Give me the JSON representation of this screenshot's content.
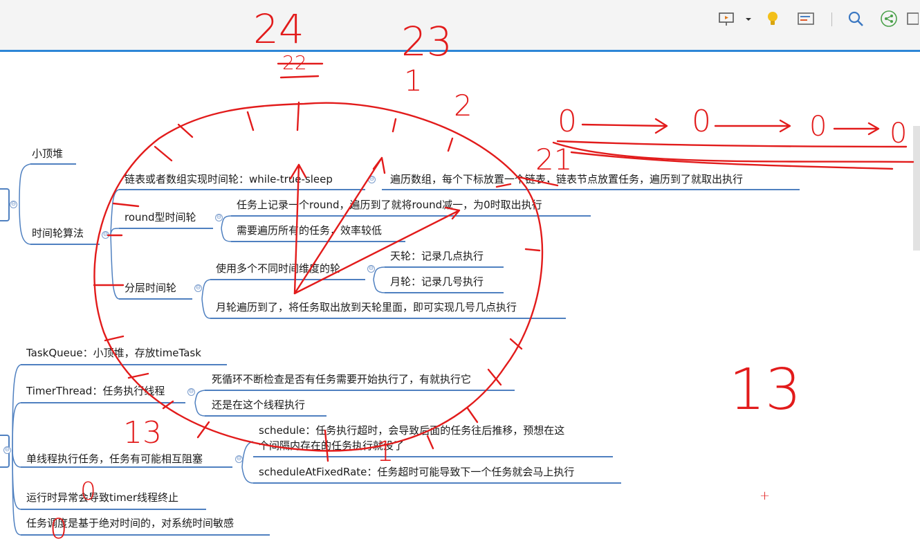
{
  "toolbar": {
    "icons": [
      "presentation-icon",
      "dropdown-arrow-icon",
      "lightbulb-icon",
      "outline-icon",
      "search-icon",
      "share-icon",
      "window-icon"
    ]
  },
  "mindmap": {
    "node_min_heap": "小顶堆",
    "node_time_wheel": "时间轮算法",
    "node_linked": "链表或者数组实现时间轮：while-true-sleep",
    "node_linked_detail": "遍历数组，每个下标放置一个链表，链表节点放置任务，遍历到了就取出执行",
    "node_round": "round型时间轮",
    "node_round_1": "任务上记录一个round，遍历到了就将round减一，为0时取出执行",
    "node_round_2": "需要遍历所有的任务，效率较低",
    "node_layer": "分层时间轮",
    "node_layer_multi": "使用多个不同时间维度的轮",
    "node_day_wheel": "天轮：记录几点执行",
    "node_month_wheel": "月轮：记录几号执行",
    "node_layer_2": "月轮遍历到了，将任务取出放到天轮里面，即可实现几号几点执行",
    "node_taskqueue": "TaskQueue：小顶堆，存放timeTask",
    "node_timerthread": "TimerThread：任务执行线程",
    "node_timerthread_1": "死循环不断检查是否有任务需要开始执行了，有就执行它",
    "node_timerthread_2": "还是在这个线程执行",
    "node_single": "单线程执行任务，任务有可能相互阻塞",
    "node_schedule_line1": "schedule：任务执行超时，会导致后面的任务往后推移，预想在这",
    "node_schedule_line2": "个间隔内存在的任务执行就没了",
    "node_fixed_rate": "scheduleAtFixedRate：任务超时可能导致下一个任务就会马上执行",
    "node_runtime": "运行时异常会导致timer线程终止",
    "node_abs_time": "任务调度是基于绝对时间的，对系统时间敏感",
    "collapse_symbol": "⊖"
  },
  "annotations": {
    "n24": "24",
    "n23": "23",
    "n22": "22",
    "n1": "1",
    "n2": "2",
    "n21": "21",
    "n13_big": "13",
    "n13_small": "13",
    "n1_bottom": "1",
    "zero_1": "0",
    "zero_2": "0",
    "zero_3": "0",
    "zero_4": "0",
    "zero_5": "0",
    "zero_6": "0",
    "plus": "+"
  },
  "colors": {
    "ink": "#e21b1b",
    "branch": "#4f80c0",
    "toolbar_accent": "#2d86d6"
  }
}
